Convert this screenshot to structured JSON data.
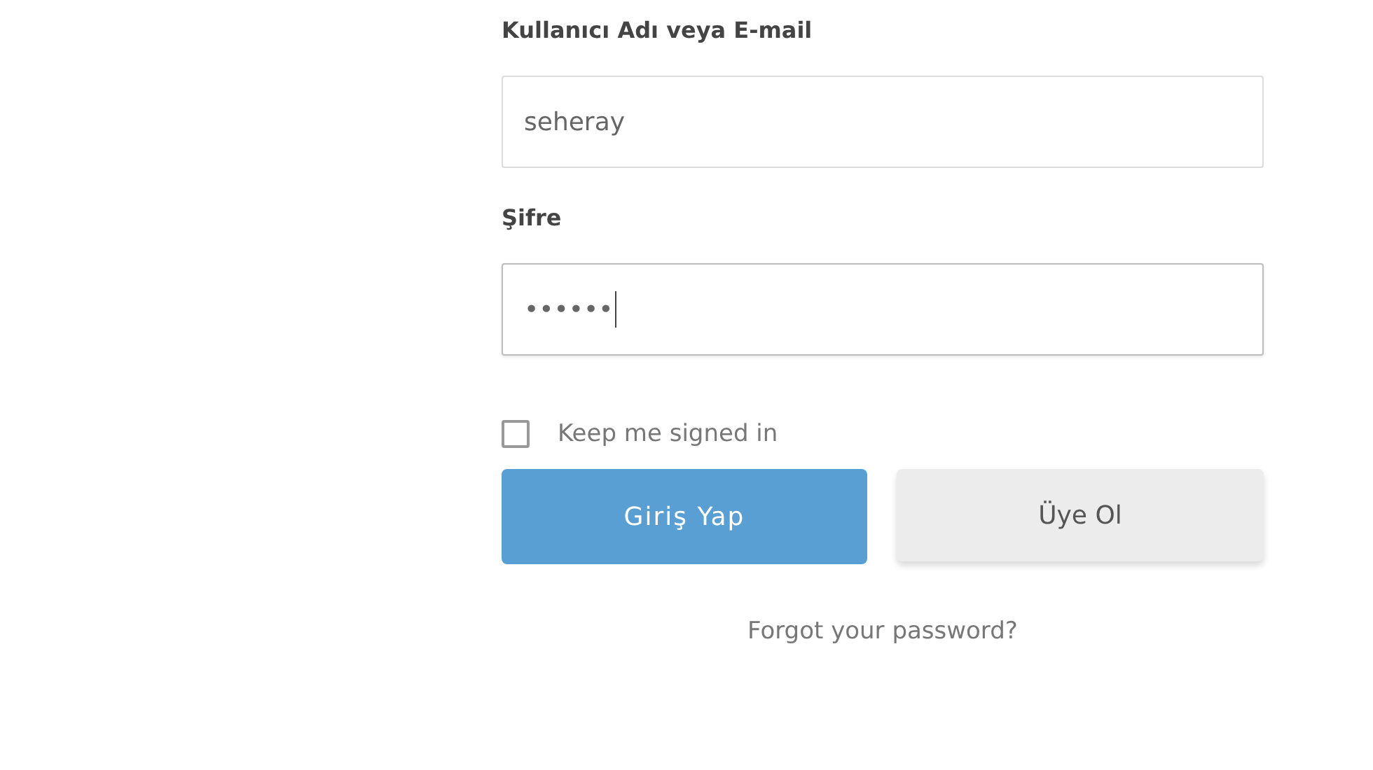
{
  "fields": [
    {
      "label": "Kullanıcı Adı veya E-mail",
      "value": "seheray",
      "focused": false
    },
    {
      "label": "Şifre",
      "value": "••••••",
      "focused": true
    }
  ],
  "remember": {
    "label": "Keep me signed in",
    "checked": false
  },
  "buttons": [
    {
      "label": "Giriş Yap",
      "kind": "primary"
    },
    {
      "label": "Üye Ol",
      "kind": "secondary"
    }
  ],
  "forgot_link": "Forgot your password?"
}
